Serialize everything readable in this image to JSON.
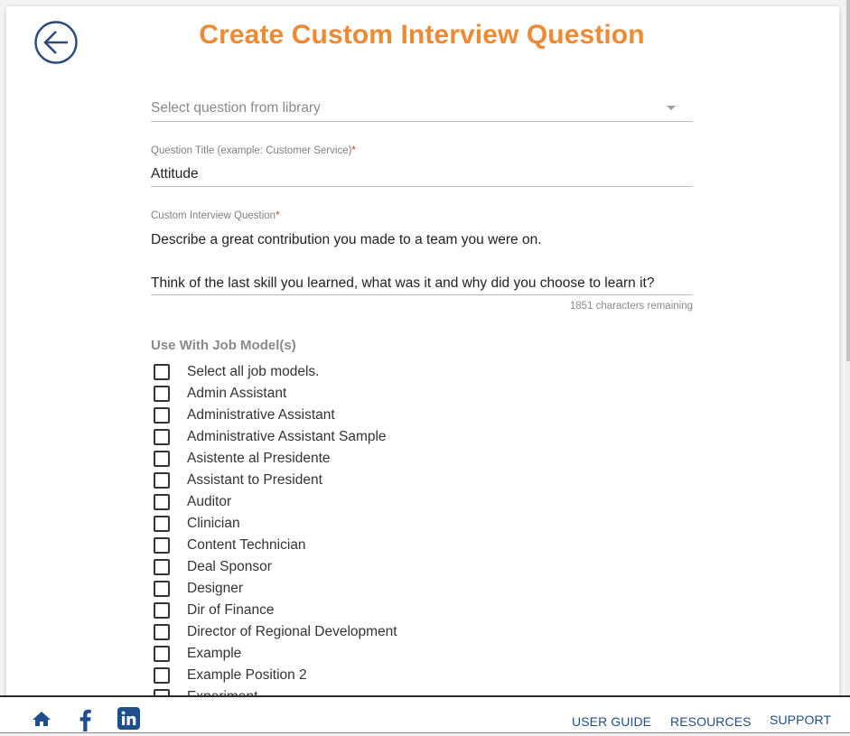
{
  "page": {
    "title": "Create Custom Interview Question"
  },
  "form": {
    "library_select": {
      "placeholder": "Select question from library"
    },
    "question_title": {
      "label": "Question Title (example: Customer Service)",
      "required_mark": "*",
      "value": "Attitude"
    },
    "custom_question": {
      "label": "Custom Interview Question",
      "required_mark": "*",
      "value": "Describe a great contribution you made to a team you were on.\n\nThink of the last skill you learned, what was it and why did you choose to learn it?",
      "char_count": "1851 characters remaining"
    },
    "job_models": {
      "heading": "Use With Job Model(s)",
      "items": [
        {
          "label": "Select all job models.",
          "checked": false
        },
        {
          "label": "Admin Assistant",
          "checked": false
        },
        {
          "label": "Administrative Assistant",
          "checked": false
        },
        {
          "label": "Administrative Assistant Sample",
          "checked": false
        },
        {
          "label": "Asistente al Presidente",
          "checked": false
        },
        {
          "label": "Assistant to President",
          "checked": false
        },
        {
          "label": "Auditor",
          "checked": false
        },
        {
          "label": "Clinician",
          "checked": false
        },
        {
          "label": "Content Technician",
          "checked": false
        },
        {
          "label": "Deal Sponsor",
          "checked": false
        },
        {
          "label": "Designer",
          "checked": false
        },
        {
          "label": "Dir of Finance",
          "checked": false
        },
        {
          "label": "Director of Regional Development",
          "checked": false
        },
        {
          "label": "Example",
          "checked": false
        },
        {
          "label": "Example Position 2",
          "checked": false
        },
        {
          "label": "Experiment",
          "checked": false
        }
      ]
    }
  },
  "footer": {
    "icons": [
      "home-icon",
      "facebook-icon",
      "linkedin-icon"
    ],
    "links": {
      "user_guide": "USER GUIDE",
      "resources": "RESOURCES",
      "support": "SUPPORT"
    }
  },
  "colors": {
    "title": "#ed8a34",
    "brand_blue": "#1f4e8c",
    "back_icon": "#2c4a7c",
    "required": "#e53935"
  }
}
